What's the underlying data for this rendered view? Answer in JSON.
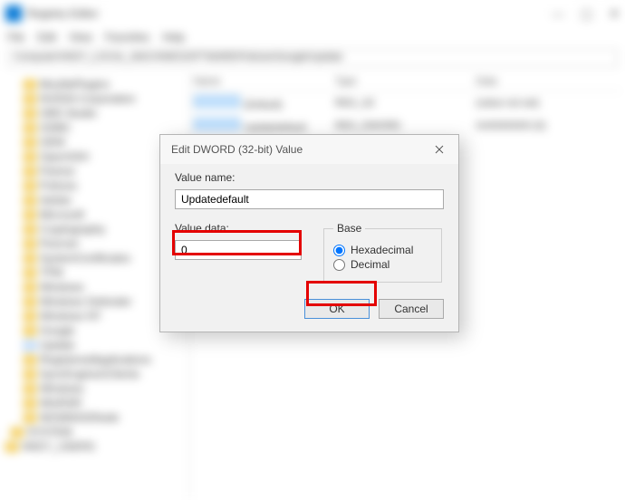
{
  "app": {
    "title": "Registry Editor",
    "menu": [
      "File",
      "Edit",
      "View",
      "Favorites",
      "Help"
    ],
    "address": "Computer\\HKEY_LOCAL_MACHINE\\SOFTWARE\\Policies\\Google\\Update",
    "window_controls": {
      "min": "—",
      "max": "▢",
      "close": "✕"
    }
  },
  "tree": {
    "items": [
      {
        "label": "MozillaPlugins"
      },
      {
        "label": "NVIDIA Corporation"
      },
      {
        "label": "OBS Studio"
      },
      {
        "label": "ODBC"
      },
      {
        "label": "OEM"
      },
      {
        "label": "OpenSSH"
      },
      {
        "label": "Partner"
      },
      {
        "label": "Policies"
      },
      {
        "label": "Adobe"
      },
      {
        "label": "Microsoft"
      },
      {
        "label": "Cryptography"
      },
      {
        "label": "Peernet"
      },
      {
        "label": "SystemCertificates"
      },
      {
        "label": "TPM"
      },
      {
        "label": "Windows"
      },
      {
        "label": "Windows Defender"
      },
      {
        "label": "Windows NT"
      },
      {
        "label": "Google"
      },
      {
        "label": "Update"
      },
      {
        "label": "RegisteredApplications"
      },
      {
        "label": "SyncEngines\\Clients"
      },
      {
        "label": "Windows"
      },
      {
        "label": "WinRAR"
      },
      {
        "label": "WOW6432Node"
      },
      {
        "label": "SYSTEM"
      },
      {
        "label": "HKEY_USERS"
      }
    ]
  },
  "list": {
    "columns": [
      "Name",
      "Type",
      "Data"
    ],
    "rows": [
      {
        "name": "(Default)",
        "type": "REG_SZ",
        "data": "(value not set)"
      },
      {
        "name": "Updatedefault",
        "type": "REG_DWORD",
        "data": "0x00000000 (0)"
      }
    ]
  },
  "dialog": {
    "title": "Edit DWORD (32-bit) Value",
    "value_name_label": "Value name:",
    "value_name": "Updatedefault",
    "value_data_label": "Value data:",
    "value_data": "0",
    "base_legend": "Base",
    "radio_hex": "Hexadecimal",
    "radio_dec": "Decimal",
    "ok": "OK",
    "cancel": "Cancel"
  }
}
